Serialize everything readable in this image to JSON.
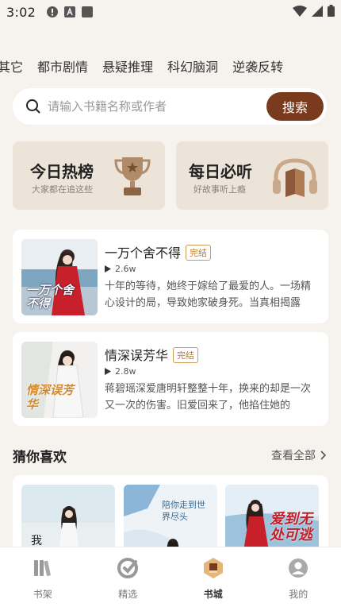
{
  "status_bar": {
    "time": "3:02"
  },
  "categories": [
    "其它",
    "都市剧情",
    "悬疑推理",
    "科幻脑洞",
    "逆袭反转"
  ],
  "search": {
    "placeholder": "请输入书籍名称或作者",
    "button_label": "搜索"
  },
  "promos": [
    {
      "title": "今日热榜",
      "subtitle": "大家都在追这些",
      "icon": "trophy-icon"
    },
    {
      "title": "每日必听",
      "subtitle": "好故事听上瘾",
      "icon": "headphones-book-icon"
    }
  ],
  "books": [
    {
      "title": "一万个舍不得",
      "badge": "完结",
      "plays": "2.6w",
      "description": "十年的等待，她终于嫁给了最爱的人。一场精心设计的局，导致她家破身死。当真相揭露",
      "cover_text": "一万个舍不得"
    },
    {
      "title": "情深误芳华",
      "badge": "完结",
      "plays": "2.8w",
      "description": "蒋碧瑶深爱唐明轩整整十年，换来的却是一次又一次的伤害。旧爱回来了，他掐住她的",
      "cover_text": "情深误芳华"
    }
  ],
  "guess_section": {
    "title": "猜你喜欢",
    "more_label": "查看全部",
    "covers": [
      {
        "text": "我"
      },
      {
        "text": "陪你走到世界尽头"
      },
      {
        "text": "爱到无处可逃"
      }
    ]
  },
  "bottom_nav": [
    {
      "label": "书架",
      "icon": "bookshelf-icon",
      "active": false
    },
    {
      "label": "精选",
      "icon": "featured-icon",
      "active": false
    },
    {
      "label": "书城",
      "icon": "bookstore-icon",
      "active": true
    },
    {
      "label": "我的",
      "icon": "profile-icon",
      "active": false
    }
  ],
  "colors": {
    "accent": "#7a3a1d",
    "badge": "#b77b2a",
    "background": "#f6f3ee"
  }
}
